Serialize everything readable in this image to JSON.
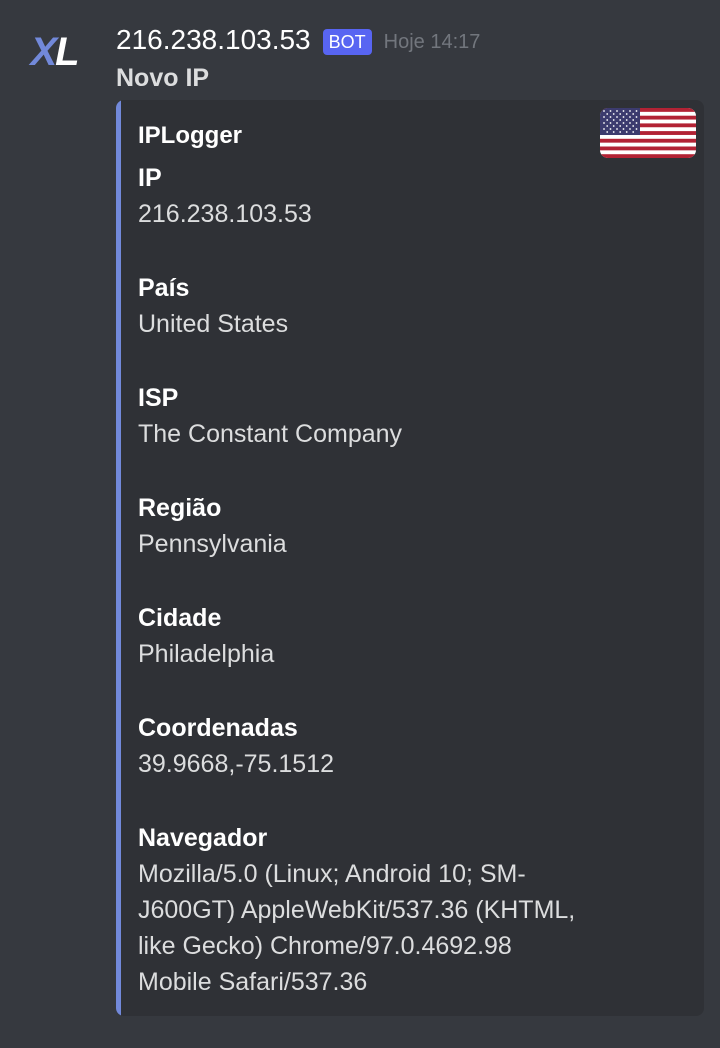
{
  "message": {
    "avatar_text_x": "X",
    "avatar_text_l": "L",
    "username": "216.238.103.53",
    "bot_tag": "BOT",
    "timestamp": "Hoje 14:17",
    "content": "Novo IP"
  },
  "embed": {
    "accent_color": "#7289da",
    "title": "IPLogger",
    "thumbnail_icon": "us-flag-icon",
    "fields": [
      {
        "name": "IP",
        "value": "216.238.103.53"
      },
      {
        "name": "País",
        "value": "United States"
      },
      {
        "name": "ISP",
        "value": "The Constant Company"
      },
      {
        "name": "Região",
        "value": "Pennsylvania"
      },
      {
        "name": "Cidade",
        "value": "Philadelphia"
      },
      {
        "name": "Coordenadas",
        "value": "39.9668,-75.1512"
      },
      {
        "name": "Navegador",
        "value": "Mozilla/5.0 (Linux; Android 10; SM-J600GT) AppleWebKit/537.36 (KHTML, like Gecko) Chrome/97.0.4692.98 Mobile Safari/537.36"
      }
    ]
  },
  "colors": {
    "background": "#36393f",
    "embed_background": "#2f3136",
    "bot_tag": "#5865f2",
    "timestamp": "#72767d"
  }
}
